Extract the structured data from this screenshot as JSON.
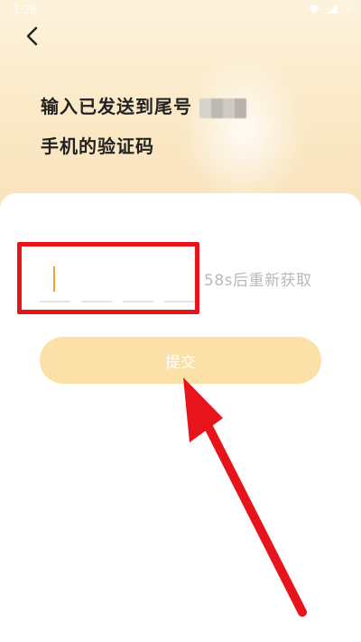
{
  "status_bar": {
    "time": "1:26"
  },
  "header": {
    "title_line1": "输入已发送到尾号",
    "title_line2": "手机的验证码"
  },
  "verification": {
    "code_length": 4,
    "resend_text": "58s后重新获取"
  },
  "actions": {
    "submit_label": "提交"
  },
  "colors": {
    "accent": "#f1a12b",
    "button_disabled": "#fbe0a7",
    "annotation_red": "#e8141b",
    "header_bg": "#fbe8c5"
  }
}
